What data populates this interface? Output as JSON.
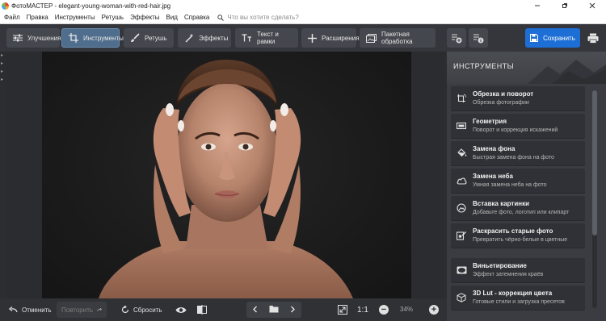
{
  "window": {
    "title": "ФотоМАСТЕР - elegant-young-woman-with-red-hair.jpg",
    "controls": [
      "minimize-icon",
      "maximize-icon",
      "close-icon"
    ]
  },
  "menu": {
    "items": [
      "Файл",
      "Правка",
      "Инструменты",
      "Ретушь",
      "Эффекты",
      "Вид",
      "Справка"
    ],
    "search_placeholder": "Что вы хотите сделать?"
  },
  "toolbar": {
    "tabs": [
      {
        "label": "Улучшения",
        "icon": "sliders-icon"
      },
      {
        "label": "Инструменты",
        "icon": "crop-icon",
        "active": true
      },
      {
        "label": "Ретушь",
        "icon": "brush-icon"
      },
      {
        "label": "Эффекты",
        "icon": "magic-icon"
      },
      {
        "label": "Текст и рамки",
        "icon": "text-icon"
      },
      {
        "label": "Расширения",
        "icon": "plus-icon"
      },
      {
        "label": "Пакетная обработка",
        "icon": "batch-icon"
      }
    ],
    "history_icons": [
      "history-add-icon",
      "history-info-icon"
    ],
    "save_label": "Сохранить",
    "print_icon": "print-icon"
  },
  "panel": {
    "title": "ИНСТРУМЕНТЫ",
    "tools": [
      {
        "title": "Обрезка и поворот",
        "subtitle": "Обрезка фотографии",
        "icon": "crop-rotate-icon"
      },
      {
        "title": "Геометрия",
        "subtitle": "Поворот и коррекция искажений",
        "icon": "geometry-icon"
      },
      {
        "title": "Замена фона",
        "subtitle": "Быстрая замена фона на фото",
        "icon": "bucket-icon"
      },
      {
        "title": "Замена неба",
        "subtitle": "Умная замена неба на фото",
        "icon": "cloud-icon"
      },
      {
        "title": "Вставка картинки",
        "subtitle": "Добавьте фото, логотип или клипарт",
        "icon": "insert-image-icon"
      },
      {
        "title": "Раскрасить старые фото",
        "subtitle": "Превратить чёрно-белые в цветные",
        "icon": "colorize-icon"
      },
      {
        "title": "Виньетирование",
        "subtitle": "Эффект затемнения краёв",
        "icon": "vignette-icon"
      },
      {
        "title": "3D Lut - коррекция цвета",
        "subtitle": "Готовые стили и загрузка пресетов",
        "icon": "cube-icon"
      }
    ]
  },
  "bottom": {
    "undo_label": "Отменить",
    "redo_label": "Повторить",
    "reset_label": "Сбросить",
    "ratio_label": "1:1",
    "zoom_label": "34%"
  },
  "colors": {
    "accent": "#1d6fd6",
    "active_tab": "#4f6d8c",
    "background": "#2b2d31"
  }
}
